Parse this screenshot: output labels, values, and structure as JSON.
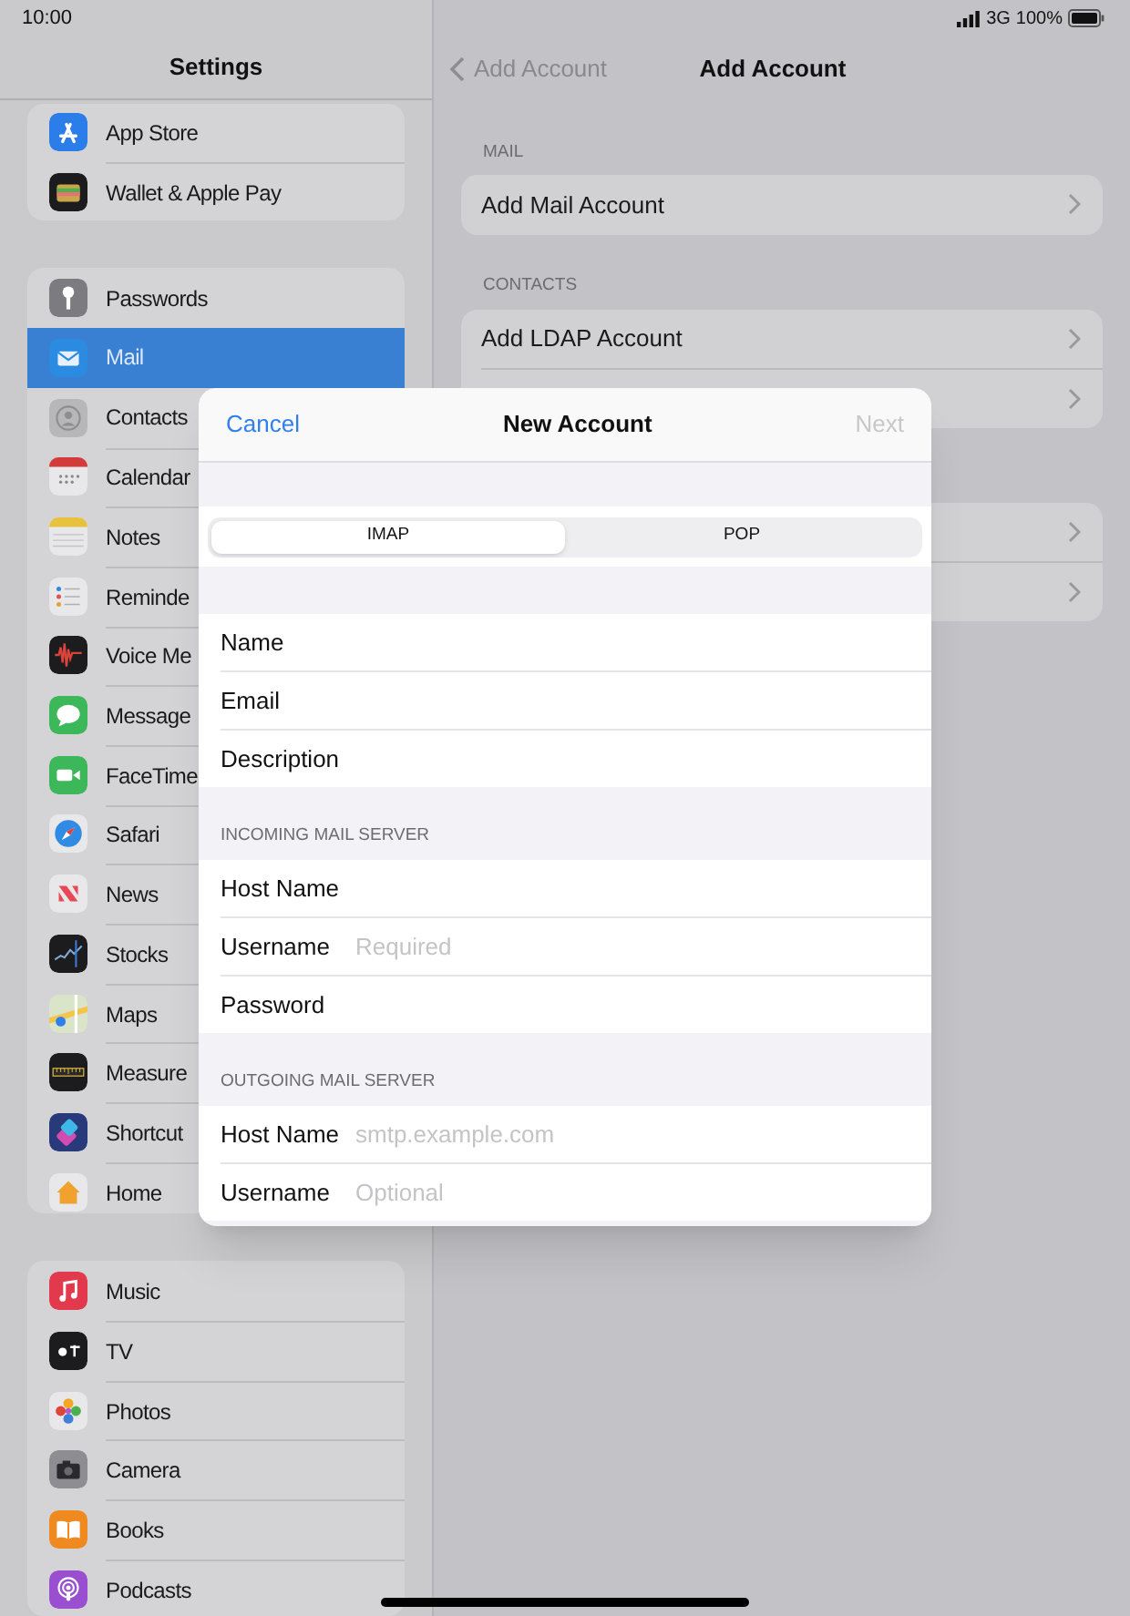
{
  "status_bar": {
    "time": "10:00",
    "network": "3G",
    "battery": "100%"
  },
  "sidebar": {
    "title": "Settings",
    "groups": [
      {
        "items": [
          {
            "label": "App Store",
            "selected": false
          },
          {
            "label": "Wallet & Apple Pay",
            "selected": false
          }
        ]
      },
      {
        "items": [
          {
            "label": "Passwords",
            "selected": false
          },
          {
            "label": "Mail",
            "selected": true
          },
          {
            "label": "Contacts",
            "selected": false
          },
          {
            "label": "Calendar",
            "selected": false
          },
          {
            "label": "Notes",
            "selected": false
          },
          {
            "label": "Reminde",
            "selected": false
          },
          {
            "label": "Voice Me",
            "selected": false
          },
          {
            "label": "Message",
            "selected": false
          },
          {
            "label": "FaceTime",
            "selected": false
          },
          {
            "label": "Safari",
            "selected": false
          },
          {
            "label": "News",
            "selected": false
          },
          {
            "label": "Stocks",
            "selected": false
          },
          {
            "label": "Maps",
            "selected": false
          },
          {
            "label": "Measure",
            "selected": false
          },
          {
            "label": "Shortcut",
            "selected": false
          },
          {
            "label": "Home",
            "selected": false
          }
        ]
      },
      {
        "items": [
          {
            "label": "Music",
            "selected": false
          },
          {
            "label": "TV",
            "selected": false
          },
          {
            "label": "Photos",
            "selected": false
          },
          {
            "label": "Camera",
            "selected": false
          },
          {
            "label": "Books",
            "selected": false
          },
          {
            "label": "Podcasts",
            "selected": false
          }
        ]
      }
    ]
  },
  "detail": {
    "back": "Add Account",
    "title": "Add Account",
    "sections": [
      {
        "header": "MAIL",
        "rows": [
          {
            "kind": "link",
            "label": "Add Mail Account"
          }
        ]
      },
      {
        "header": "CONTACTS",
        "rows": [
          {
            "kind": "link",
            "label": "Add LDAP Account"
          },
          {
            "kind": "covered"
          }
        ]
      },
      {
        "rows": [
          {
            "kind": "covered"
          },
          {
            "kind": "covered"
          }
        ]
      }
    ]
  },
  "dialog": {
    "cancel": "Cancel",
    "title": "New Account",
    "next": {
      "label": "Next",
      "disabled": true
    },
    "segments": [
      {
        "label": "IMAP",
        "selected": true
      },
      {
        "label": "POP",
        "selected": false
      }
    ],
    "sections": [
      {
        "fields": [
          {
            "label": "Name"
          },
          {
            "label": "Email"
          },
          {
            "label": "Description"
          }
        ]
      },
      {
        "header": "INCOMING MAIL SERVER",
        "fields": [
          {
            "label": "Host Name"
          },
          {
            "label": "Username",
            "placeholder": "Required"
          },
          {
            "label": "Password"
          }
        ]
      },
      {
        "header": "OUTGOING MAIL SERVER",
        "fields": [
          {
            "label": "Host Name",
            "placeholder": "smtp.example.com"
          },
          {
            "label": "Username",
            "placeholder": "Optional"
          }
        ]
      }
    ]
  }
}
